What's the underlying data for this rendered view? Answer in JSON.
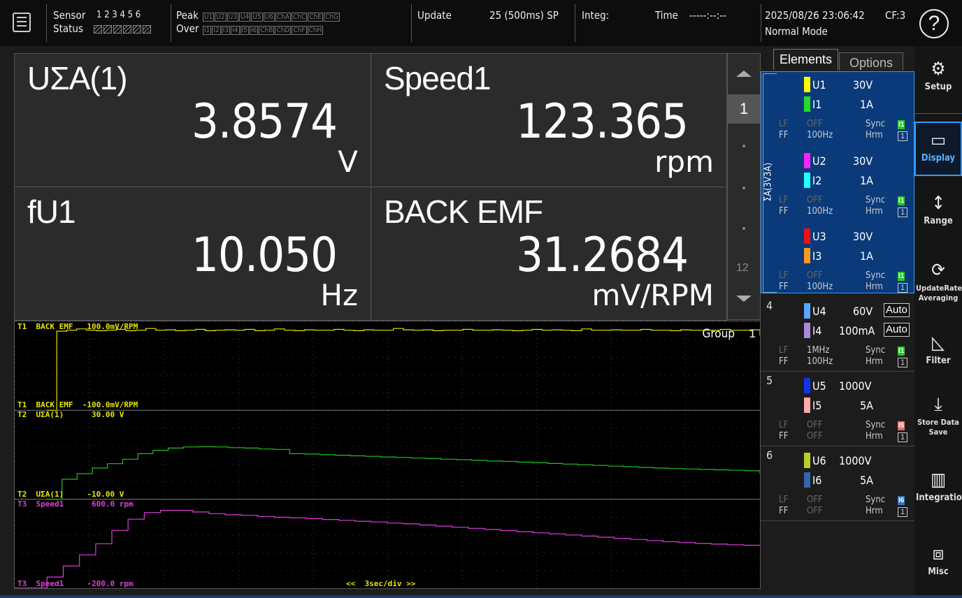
{
  "topbar": {
    "sensor_label": "Sensor",
    "status_label": "Status",
    "sensor_numbers": "1 2 3 4 5 6",
    "peak_label": "Peak",
    "over_label": "Over",
    "peak_chips": [
      "U1",
      "U2",
      "U3",
      "U4",
      "U5",
      "U6",
      "ChA",
      "ChC",
      "ChE",
      "ChG"
    ],
    "over_chips": [
      "I1",
      "I2",
      "I3",
      "I4",
      "I5",
      "I6",
      "ChB",
      "ChD",
      "ChF",
      "ChH"
    ],
    "update_label": "Update",
    "update_value": "25 (500ms) SP",
    "integ_label": "Integ:",
    "time_label": "Time",
    "time_value": "-----:--:--",
    "datetime": "2025/08/26 23:06:42",
    "cf": "CF:3",
    "mode": "Normal Mode",
    "help_symbol": "?"
  },
  "values": [
    {
      "name": "UΣA(1)",
      "value": "3.8574",
      "unit": "V"
    },
    {
      "name": "Speed1",
      "value": "123.365",
      "unit": "rpm"
    },
    {
      "name": "fU1",
      "value": "10.050",
      "unit": "Hz"
    },
    {
      "name": "BACK EMF",
      "value": "31.2684",
      "unit": "mV/RPM"
    }
  ],
  "scroller": {
    "page": "1",
    "total": "12"
  },
  "trend": {
    "group_label": "Group",
    "group_number": "1",
    "timebase": "<<  3sec/div >>",
    "traces": [
      {
        "top": "T1  BACK EMF   100.0mV/RPM",
        "bottom": "T1  BACK EMF  -100.0mV/RPM",
        "color": "#e6e600",
        "values": [
          -100,
          78,
          80,
          83,
          80,
          79,
          80,
          82,
          79,
          80,
          84,
          80,
          81,
          79,
          80,
          82,
          79,
          80,
          81,
          80,
          82,
          79,
          80,
          83,
          80,
          79,
          81,
          80,
          80,
          82,
          80,
          79,
          81,
          80,
          80,
          84,
          81,
          80,
          81,
          79,
          80,
          80,
          82,
          80,
          80,
          81,
          80,
          79,
          80,
          82,
          80,
          81,
          80,
          79,
          83,
          80,
          80,
          81,
          80,
          80,
          82,
          80,
          80,
          79,
          81,
          80,
          80,
          80,
          82,
          80,
          80,
          81,
          68
        ]
      },
      {
        "top": "T2  UΣA(1)      30.00 V",
        "bottom": "T2  UΣA(1)     -10.00 V",
        "color": "#20c020",
        "values": [
          -10,
          -1,
          1.5,
          4,
          6,
          8,
          10.5,
          12,
          13,
          13.5,
          13.6,
          13.5,
          13.2,
          13,
          12.6,
          12.4,
          10.5,
          10.3,
          10.0,
          9.8,
          9.5,
          9.3,
          9.0,
          8.8,
          8.5,
          8.3,
          8.0,
          7.8,
          7.5,
          7.2,
          7.0,
          6.7,
          6.4,
          6.1,
          5.8,
          5.5,
          5.2,
          4.9,
          4.6,
          4.3,
          4.0,
          3.8,
          3.6,
          3.4,
          3.2,
          3.0,
          2.8,
          1.5
        ]
      },
      {
        "top": "T3  Speed1      600.0 rpm",
        "bottom": "T3  Speed1     -200.0 rpm",
        "color": "#e03ce0",
        "values": [
          -200,
          -200,
          -100,
          0,
          100,
          200,
          320,
          420,
          480,
          500,
          500,
          485,
          470,
          460,
          455,
          445,
          438,
          432,
          425,
          418,
          410,
          402,
          395,
          385,
          378,
          368,
          358,
          348,
          338,
          328,
          318,
          308,
          298,
          288,
          278,
          268,
          258,
          248,
          238,
          228,
          218,
          210,
          202,
          196,
          190,
          186,
          184
        ]
      }
    ]
  },
  "tabs": {
    "elements": "Elements",
    "options": "Options"
  },
  "wiring_label": "ΣA(3V3A)",
  "elements": [
    {
      "u": "U1",
      "urange": "30V",
      "i": "I1",
      "irange": "1A",
      "ucolor": "#ffff00",
      "icolor": "#22dd22",
      "lf": "OFF",
      "ff": "100Hz",
      "sync": "Sync",
      "hrm": "Hrm",
      "sync_chip": "I1",
      "sync_chip_color": "#22cc22",
      "hrm_box": "1"
    },
    {
      "u": "U2",
      "urange": "30V",
      "i": "I2",
      "irange": "1A",
      "ucolor": "#ff22ff",
      "icolor": "#22ffff",
      "lf": "OFF",
      "ff": "100Hz",
      "sync": "Sync",
      "hrm": "Hrm",
      "sync_chip": "I1",
      "sync_chip_color": "#22cc22",
      "hrm_box": "1"
    },
    {
      "u": "U3",
      "urange": "30V",
      "i": "I3",
      "irange": "1A",
      "ucolor": "#ee1111",
      "icolor": "#ff9922",
      "lf": "OFF",
      "ff": "100Hz",
      "sync": "Sync",
      "hrm": "Hrm",
      "sync_chip": "I1",
      "sync_chip_color": "#22cc22",
      "hrm_box": "1"
    },
    {
      "num": "4",
      "u": "U4",
      "urange": "60V",
      "i": "I4",
      "irange": "100mA",
      "auto": "Auto",
      "ucolor": "#55aaff",
      "icolor": "#aa88dd",
      "lf": "1MHz",
      "ff": "100Hz",
      "sync": "Sync",
      "hrm": "Hrm",
      "sync_chip": "I1",
      "sync_chip_color": "#22cc22",
      "hrm_box": "1"
    },
    {
      "num": "5",
      "u": "U5",
      "urange": "1000V",
      "i": "I5",
      "irange": "5A",
      "ucolor": "#1133ee",
      "icolor": "#ffaaaa",
      "lf": "OFF",
      "ff": "OFF",
      "sync": "Sync",
      "hrm": "Hrm",
      "sync_chip": "I5",
      "sync_chip_color": "#e07070",
      "hrm_box": "1"
    },
    {
      "num": "6",
      "u": "U6",
      "urange": "1000V",
      "i": "I6",
      "irange": "5A",
      "ucolor": "#bbcc22",
      "icolor": "#3366aa",
      "lf": "OFF",
      "ff": "OFF",
      "sync": "Sync",
      "hrm": "Hrm",
      "sync_chip": "I6",
      "sync_chip_color": "#3377bb",
      "hrm_box": "1"
    }
  ],
  "lf_label": "LF",
  "ff_label": "FF",
  "menu": [
    {
      "label": "Setup",
      "icon": "gear-icon"
    },
    {
      "label": "Display",
      "icon": "display-icon"
    },
    {
      "label": "Range",
      "icon": "range-icon"
    },
    {
      "label": "UpdateRate Averaging",
      "icon": "refresh-icon"
    },
    {
      "label": "Filter",
      "icon": "filter-icon"
    },
    {
      "label": "Store Data Save",
      "icon": "download-icon"
    },
    {
      "label": "Integration",
      "icon": "chart-icon"
    },
    {
      "label": "Misc",
      "icon": "toolbox-icon"
    }
  ],
  "colors": {
    "wiring_bg": "#0a3a7a",
    "accent": "#3399ff"
  }
}
